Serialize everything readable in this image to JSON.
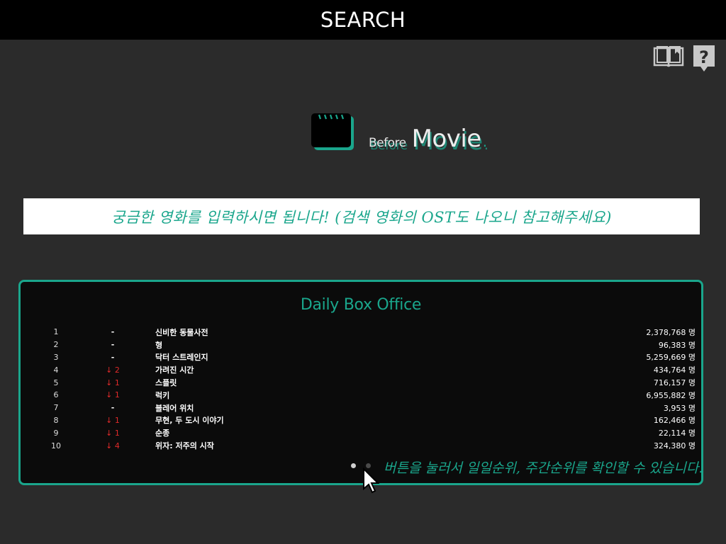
{
  "header": {
    "title": "SEARCH"
  },
  "toolbar": {
    "guide_icon": "book-icon",
    "help_icon": "question-icon"
  },
  "logo": {
    "before": "Before",
    "movie": "Movie",
    "dot": "."
  },
  "search": {
    "placeholder": "궁금한 영화를 입력하시면 됩니다! (검색 영화의 OST도 나오니 참고해주세요)"
  },
  "box_office": {
    "title": "Daily Box Office",
    "rows": [
      {
        "rank": "1",
        "change": "-",
        "change_type": "same",
        "name": "신비한 동물사전",
        "audience": "2,378,768 명"
      },
      {
        "rank": "2",
        "change": "-",
        "change_type": "same",
        "name": "형",
        "audience": "96,383 명"
      },
      {
        "rank": "3",
        "change": "-",
        "change_type": "same",
        "name": "닥터 스트레인지",
        "audience": "5,259,669 명"
      },
      {
        "rank": "4",
        "change": "↓ 2",
        "change_type": "down",
        "name": "가려진 시간",
        "audience": "434,764 명"
      },
      {
        "rank": "5",
        "change": "↓ 1",
        "change_type": "down",
        "name": "스플릿",
        "audience": "716,157 명"
      },
      {
        "rank": "6",
        "change": "↓ 1",
        "change_type": "down",
        "name": "럭키",
        "audience": "6,955,882 명"
      },
      {
        "rank": "7",
        "change": "-",
        "change_type": "same",
        "name": "블레어 위치",
        "audience": "3,953 명"
      },
      {
        "rank": "8",
        "change": "↓ 1",
        "change_type": "down",
        "name": "무현, 두 도시 이야기",
        "audience": "162,466 명"
      },
      {
        "rank": "9",
        "change": "↓ 1",
        "change_type": "down",
        "name": "순종",
        "audience": "22,114 명"
      },
      {
        "rank": "10",
        "change": "↓ 4",
        "change_type": "down",
        "name": "위자: 저주의 시작",
        "audience": "324,380 명"
      }
    ],
    "hint": "버튼을 눌러서 일일순위, 주간순위를 확인할 수 있습니다."
  },
  "colors": {
    "accent": "#1aa68c",
    "down": "#e02a2a",
    "background": "#2b2b2b"
  }
}
